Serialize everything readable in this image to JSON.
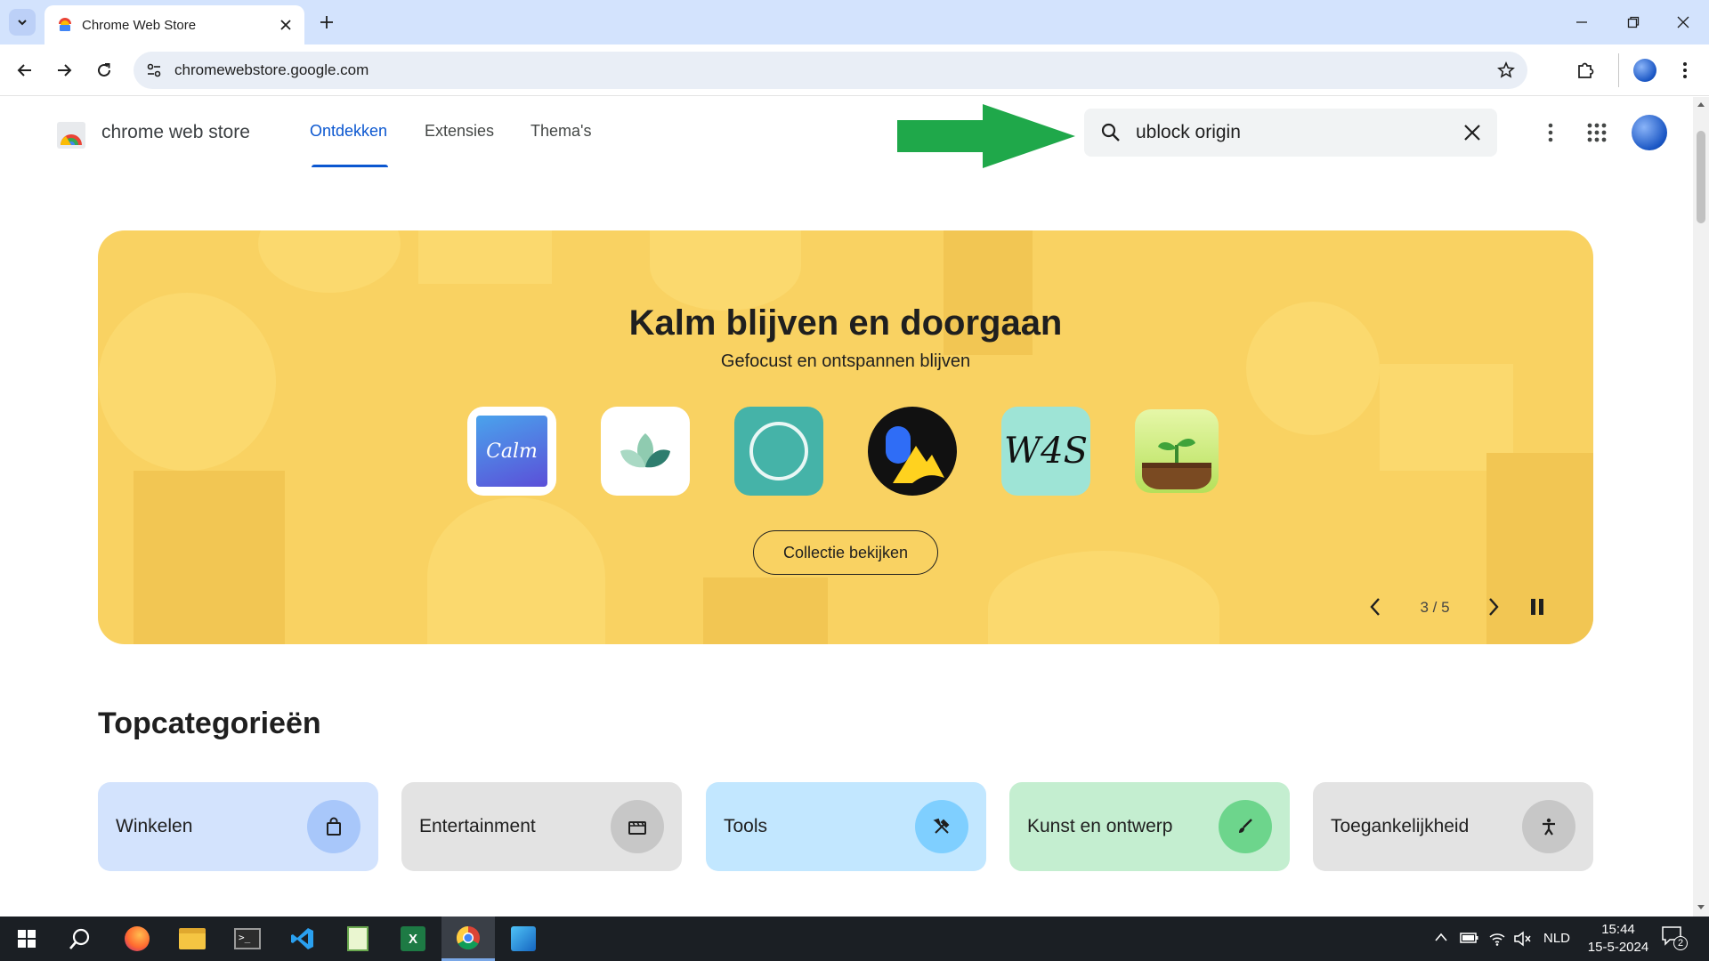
{
  "browser": {
    "tab_title": "Chrome Web Store",
    "url": "chromewebstore.google.com"
  },
  "store": {
    "brand": "chrome web store",
    "nav_tabs": [
      {
        "label": "Ontdekken",
        "active": true
      },
      {
        "label": "Extensies",
        "active": false
      },
      {
        "label": "Thema's",
        "active": false
      }
    ],
    "search_value": "ublock origin",
    "accent_color": "#0b57d0"
  },
  "banner": {
    "title": "Kalm blijven en doorgaan",
    "subtitle": "Gefocust en ontspannen blijven",
    "apps": [
      {
        "name": "calm-app-icon",
        "text": "Calm"
      },
      {
        "name": "lotus-app-icon",
        "text": ""
      },
      {
        "name": "circle-app-icon",
        "text": ""
      },
      {
        "name": "mountain-app-icon",
        "text": ""
      },
      {
        "name": "w4s-app-icon",
        "text": "W4S"
      },
      {
        "name": "forest-sprout-app-icon",
        "text": ""
      }
    ],
    "button_label": "Collectie bekijken",
    "counter": "3 / 5",
    "background_color": "#f9d262"
  },
  "categories": {
    "heading": "Topcategorieën",
    "items": [
      {
        "label": "Winkelen",
        "icon": "shopping-bag-icon",
        "bg": "#d3e3fd",
        "icon_bg": "#a8c7fa"
      },
      {
        "label": "Entertainment",
        "icon": "clapperboard-icon",
        "bg": "#e3e3e3",
        "icon_bg": "#c7c7c7"
      },
      {
        "label": "Tools",
        "icon": "tools-icon",
        "bg": "#c2e7ff",
        "icon_bg": "#7fcfff"
      },
      {
        "label": "Kunst en ontwerp",
        "icon": "brush-icon",
        "bg": "#c4eed0",
        "icon_bg": "#6dd58c"
      },
      {
        "label": "Toegankelijkheid",
        "icon": "accessibility-icon",
        "bg": "#e3e3e3",
        "icon_bg": "#c7c7c7"
      }
    ]
  },
  "taskbar": {
    "language": "NLD",
    "time": "15:44",
    "date": "15-5-2024",
    "notifications": "2"
  }
}
